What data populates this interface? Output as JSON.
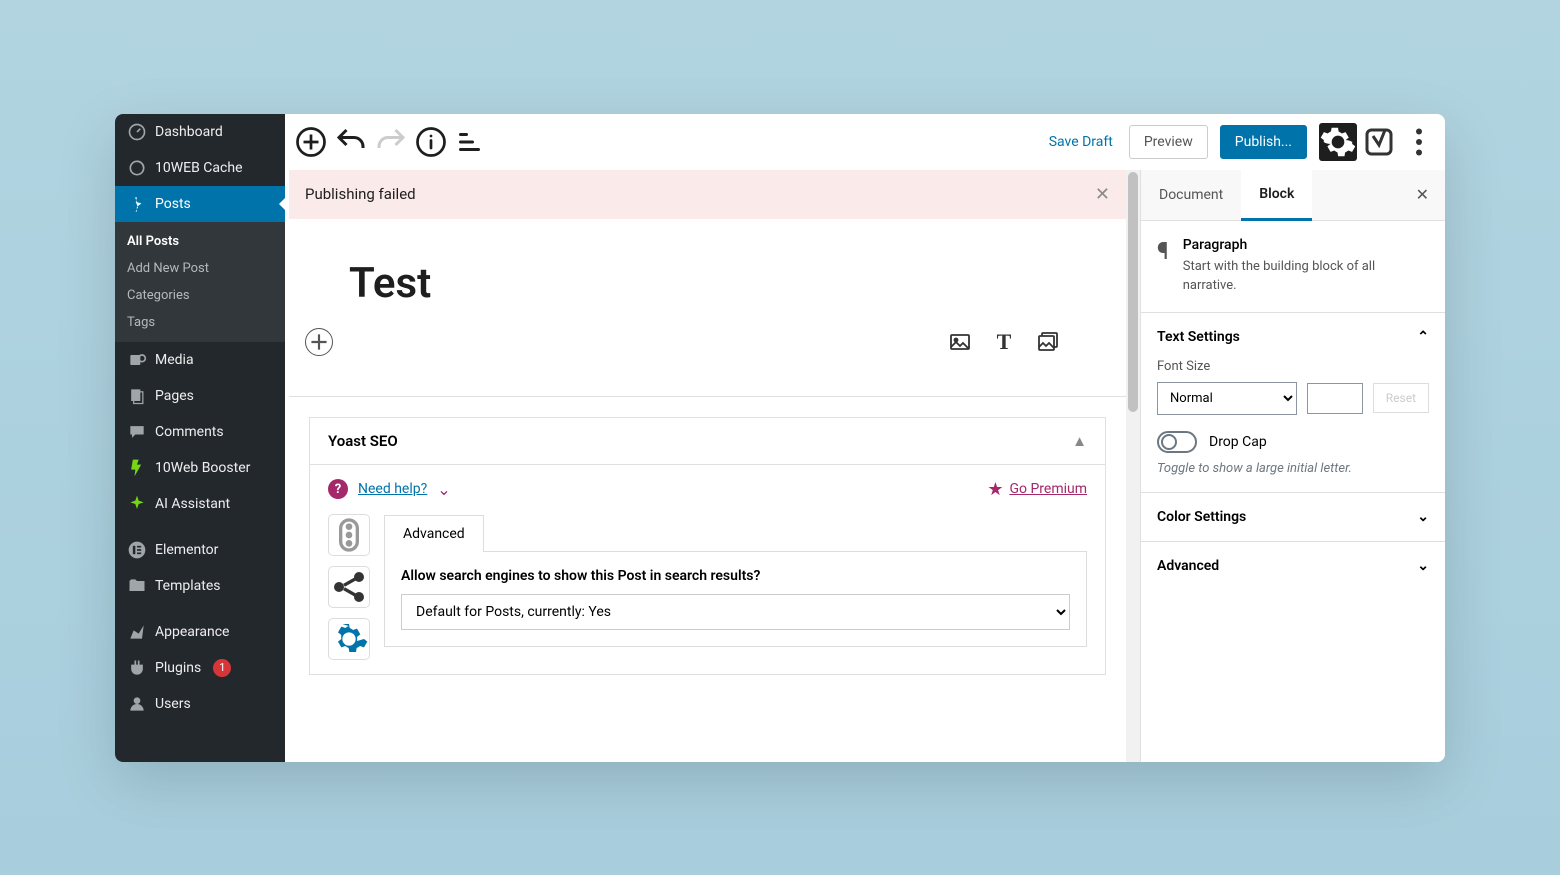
{
  "sidebar": {
    "items": [
      {
        "label": "Dashboard"
      },
      {
        "label": "10WEB Cache"
      },
      {
        "label": "Posts"
      },
      {
        "label": "Media"
      },
      {
        "label": "Pages"
      },
      {
        "label": "Comments"
      },
      {
        "label": "10Web Booster"
      },
      {
        "label": "AI Assistant"
      },
      {
        "label": "Elementor"
      },
      {
        "label": "Templates"
      },
      {
        "label": "Appearance"
      },
      {
        "label": "Plugins"
      },
      {
        "label": "Users"
      }
    ],
    "plugins_badge": "1",
    "submenu": [
      {
        "label": "All Posts"
      },
      {
        "label": "Add New Post"
      },
      {
        "label": "Categories"
      },
      {
        "label": "Tags"
      }
    ]
  },
  "toolbar": {
    "save_draft": "Save Draft",
    "preview": "Preview",
    "publish": "Publish..."
  },
  "notice": {
    "message": "Publishing failed"
  },
  "post": {
    "title": "Test"
  },
  "metabox": {
    "title": "Yoast SEO",
    "help": "Need help?",
    "premium": "Go Premium",
    "tab": "Advanced",
    "question": "Allow search engines to show this Post in search results?",
    "answer": "Default for Posts, currently: Yes"
  },
  "inspector": {
    "tabs": {
      "document": "Document",
      "block": "Block"
    },
    "block": {
      "name": "Paragraph",
      "desc": "Start with the building block of all narrative."
    },
    "text_settings": "Text Settings",
    "font_size": "Font Size",
    "font_value": "Normal",
    "reset": "Reset",
    "drop_cap": "Drop Cap",
    "drop_cap_help": "Toggle to show a large initial letter.",
    "color_settings": "Color Settings",
    "advanced": "Advanced"
  }
}
